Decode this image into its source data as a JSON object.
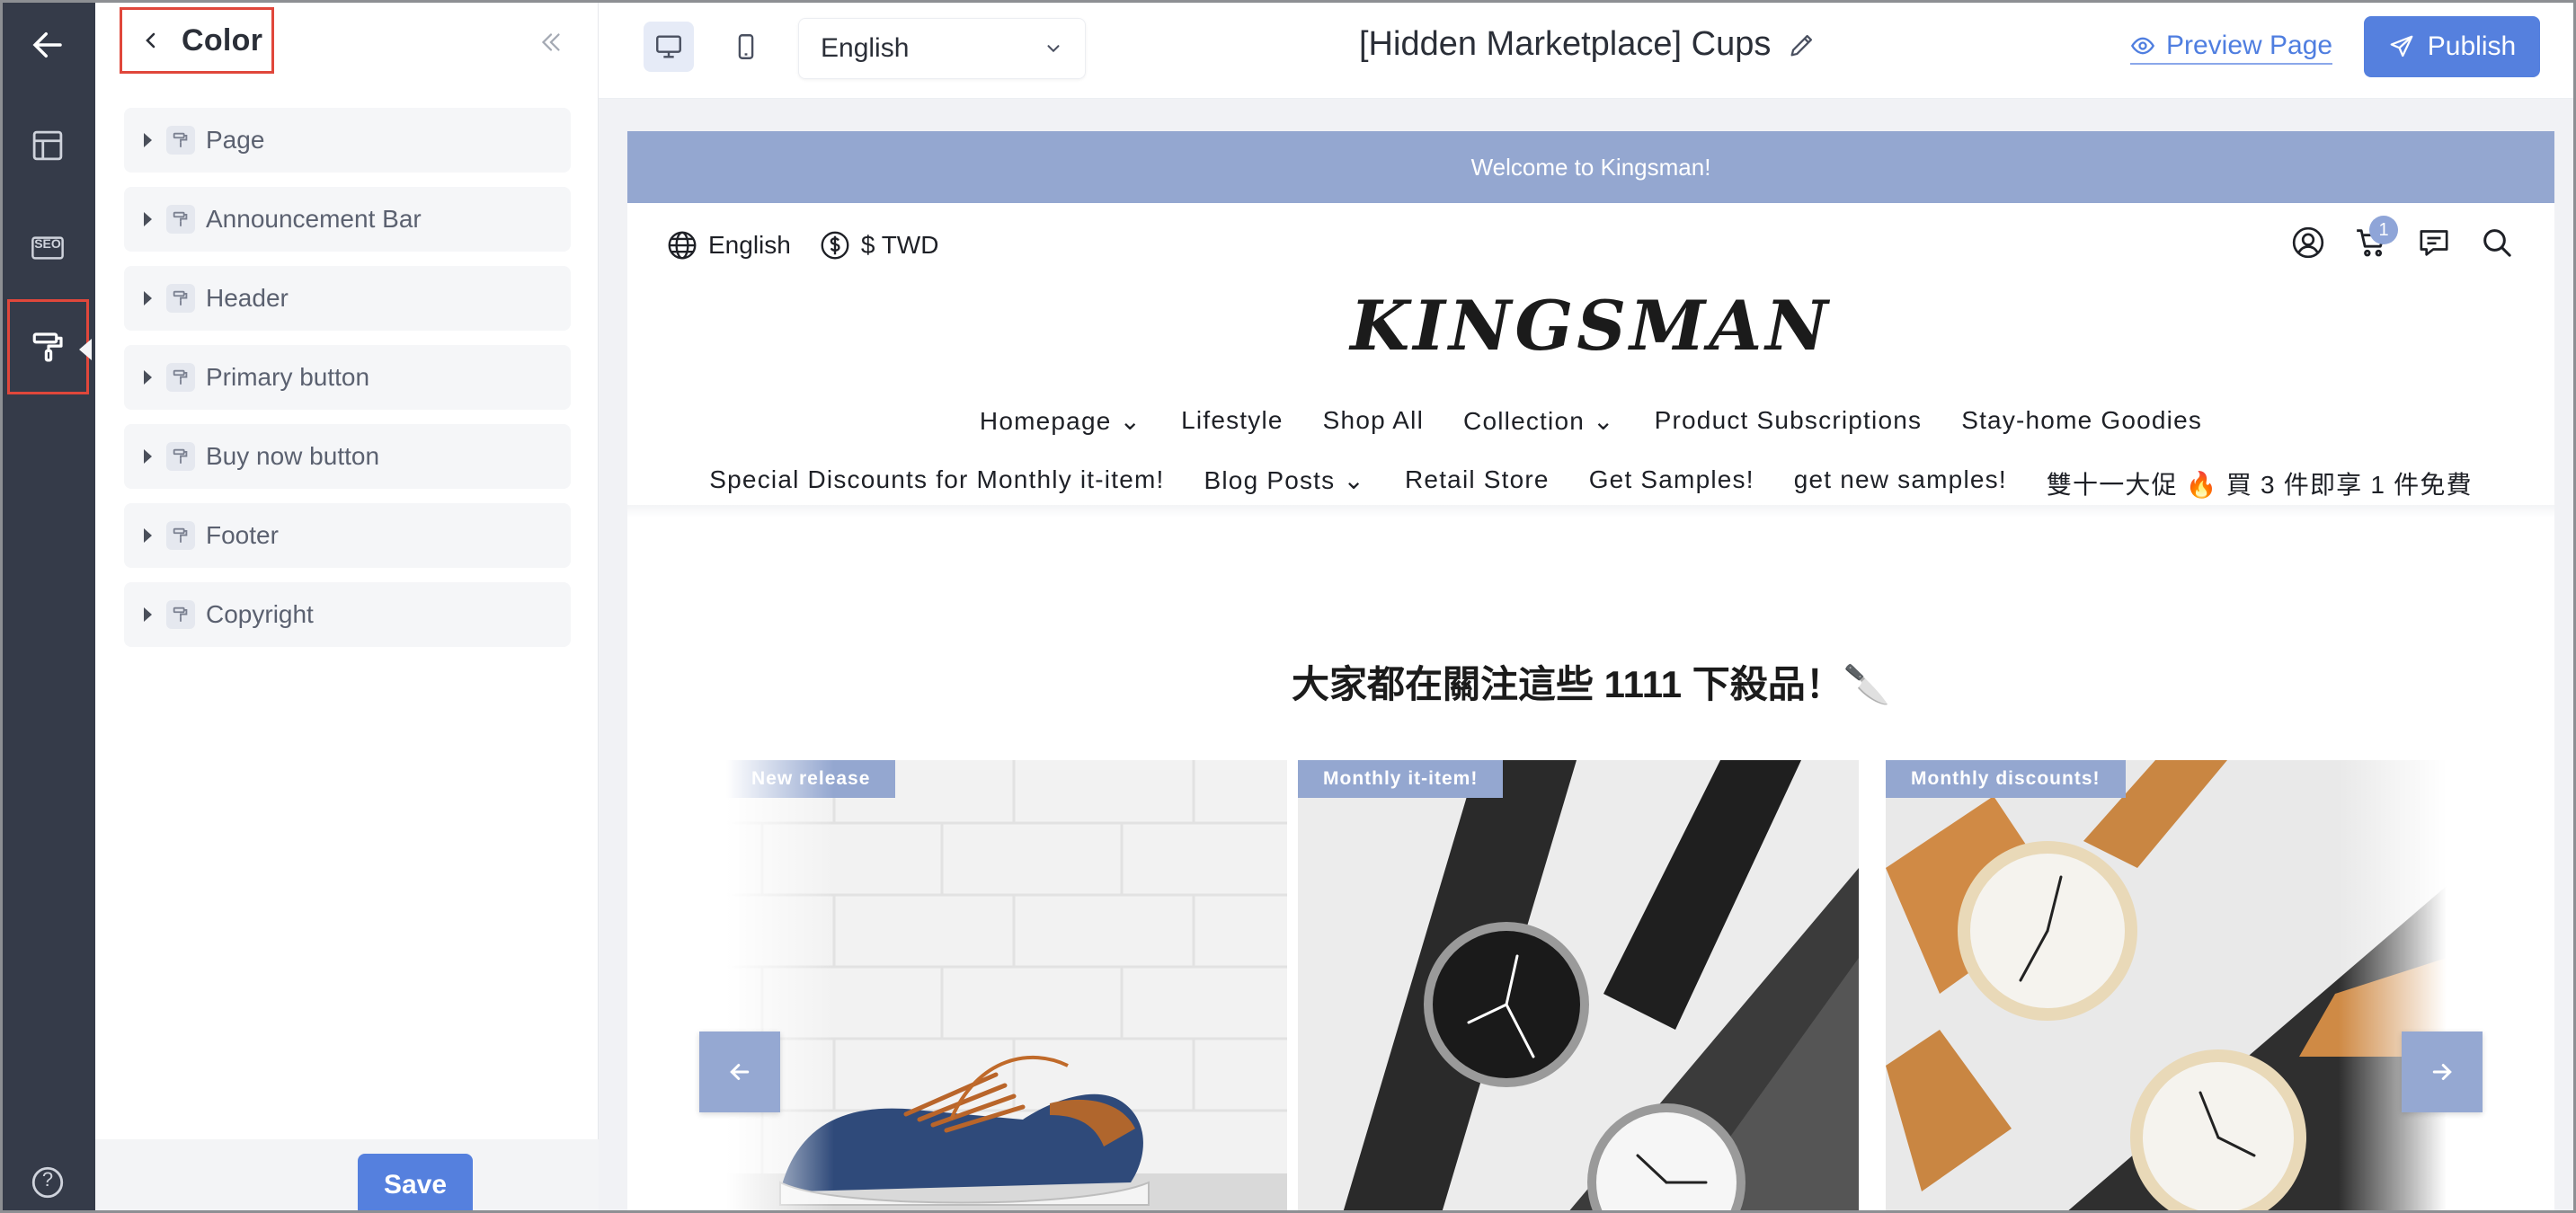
{
  "rail": {
    "items": [
      "back-arrow-icon",
      "layout-icon",
      "seo-icon",
      "paint-roller-icon",
      "help-icon"
    ],
    "seo_label": "SEO",
    "help_label": "?"
  },
  "panel": {
    "title": "Color",
    "groups": [
      {
        "label": "Page"
      },
      {
        "label": "Announcement Bar"
      },
      {
        "label": "Header"
      },
      {
        "label": "Primary button"
      },
      {
        "label": "Buy now button"
      },
      {
        "label": "Footer"
      },
      {
        "label": "Copyright"
      }
    ],
    "save_label": "Save"
  },
  "topbar": {
    "language": "English",
    "page_title": "[Hidden Marketplace] Cups",
    "preview_label": "Preview Page",
    "publish_label": "Publish"
  },
  "site": {
    "announcement": "Welcome to Kingsman!",
    "language": "English",
    "currency": "$ TWD",
    "cart_count": "1",
    "logo": "KINGSMAN",
    "nav_row1": [
      "Homepage ⌄",
      "Lifestyle",
      "Shop All",
      "Collection ⌄",
      "Product Subscriptions",
      "Stay-home Goodies"
    ],
    "nav_row2": [
      "Special Discounts for Monthly it-item!",
      "Blog Posts ⌄",
      "Retail Store",
      "Get Samples!",
      "get new samples!",
      "雙十一大促 🔥 買 3 件即享 1 件免費"
    ],
    "section_title": "大家都在關注這些 1111 下殺品！🔪",
    "cards": [
      {
        "badge": "New release"
      },
      {
        "badge": "Monthly it-item!"
      },
      {
        "badge": "Monthly discounts!"
      }
    ]
  },
  "colors": {
    "rail_bg": "#353b49",
    "accent": "#5580de",
    "highlight": "#e0473b",
    "brand_soft": "#94a7d0"
  }
}
